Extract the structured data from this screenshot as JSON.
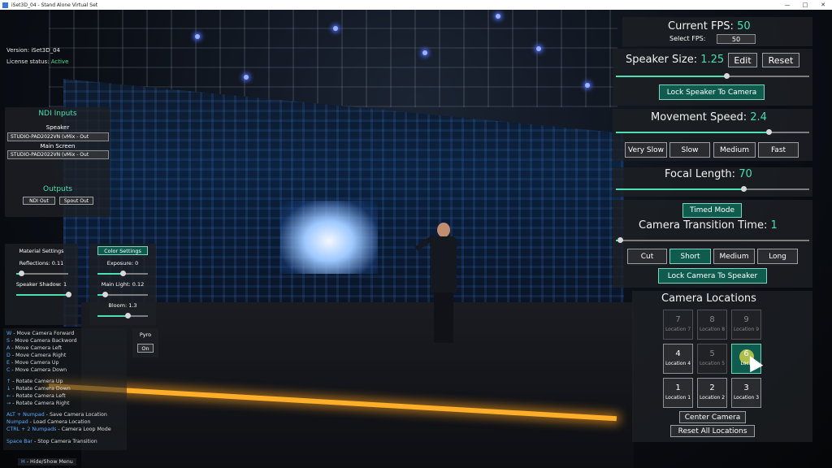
{
  "window": {
    "title": "iSet3D_04 - Stand Alone Virtual Set"
  },
  "info": {
    "version": "Version: iSet3D_04",
    "license_label": "License status:",
    "license_value": "Active"
  },
  "ndi": {
    "title": "NDI Inputs",
    "speaker_label": "Speaker",
    "speaker_value": "STUDIO-PAD2022VN (vMix - Out",
    "main_label": "Main Screen",
    "main_value": "STUDIO-PAD2022VN (vMix - Out",
    "outputs_title": "Outputs",
    "ndi_out": "NDI Out",
    "spout_out": "Spout Out"
  },
  "material": {
    "title": "Material Settings",
    "color_settings": "Color Settings",
    "reflections": "Reflections: 0.11",
    "reflections_level": 0.1,
    "speaker_shadow": "Speaker Shadow: 1",
    "speaker_shadow_level": 1,
    "exposure": "Exposure: 0",
    "exposure_level": 0.5,
    "main_light": "Main Light: 0.12",
    "main_light_level": 0.15,
    "bloom": "Bloom: 1.3",
    "bloom_level": 0.6
  },
  "pyro": {
    "label": "Pyro",
    "button": "On"
  },
  "shortcuts": {
    "camera_move": [
      {
        "key": "W",
        "desc": " - Move Camera Forward"
      },
      {
        "key": "S",
        "desc": " - Move Camera Backword"
      },
      {
        "key": "A",
        "desc": " - Move Camera Left"
      },
      {
        "key": "D",
        "desc": " - Move Camera Right"
      },
      {
        "key": "E",
        "desc": " - Move Camera Up"
      },
      {
        "key": "C",
        "desc": " - Move Camera Down"
      }
    ],
    "camera_rotate": [
      {
        "key": "↑",
        "desc": " - Rotate Camera Up"
      },
      {
        "key": "↓",
        "desc": " - Rotate Camera Down"
      },
      {
        "key": "←",
        "desc": " - Rotate Camera Left"
      },
      {
        "key": "→",
        "desc": " - Rotate Camera Right"
      }
    ],
    "location": [
      {
        "key": "ALT + Numpad",
        "desc": " - Save Camera Location"
      },
      {
        "key": "Numpad",
        "desc": " - Load Camera Location"
      },
      {
        "key": "CTRL + 2 Numpads",
        "desc": " - Camera Loop Mode"
      }
    ],
    "transition": {
      "key": "Space Bar",
      "desc": " - Stop Camera Transition"
    },
    "menu": {
      "key": "H",
      "desc": " - Hide/Show Menu"
    }
  },
  "right": {
    "fps_label": "Current FPS:",
    "fps_value": "50",
    "select_fps_label": "Select FPS:",
    "select_fps_value": "50",
    "speaker_size_label": "Speaker Size:",
    "speaker_size_value": "1.25",
    "speaker_size_level": 0.57,
    "edit": "Edit",
    "reset": "Reset",
    "lock_speaker": "Lock Speaker To Camera",
    "movement_label": "Movement Speed:",
    "movement_value": "2.4",
    "movement_level": 0.79,
    "speeds": [
      "Very Slow",
      "Slow",
      "Medium",
      "Fast"
    ],
    "focal_label": "Focal Length:",
    "focal_value": "70",
    "focal_level": 0.66,
    "timed_mode": "Timed Mode",
    "transition_label": "Camera Transition Time:",
    "transition_value": "1",
    "transition_level": 0.02,
    "transitions": [
      "Cut",
      "Short",
      "Medium",
      "Long"
    ],
    "lock_camera": "Lock Camera To Speaker",
    "locations_title": "Camera Locations",
    "locations": [
      {
        "num": "7",
        "label": "Location 7",
        "state": "dim"
      },
      {
        "num": "8",
        "label": "Location 8",
        "state": "dim"
      },
      {
        "num": "9",
        "label": "Location 9",
        "state": "dim"
      },
      {
        "num": "4",
        "label": "Location 4",
        "state": "normal"
      },
      {
        "num": "5",
        "label": "Location 5",
        "state": "dim"
      },
      {
        "num": "6",
        "label": "Loca",
        "state": "active"
      },
      {
        "num": "1",
        "label": "Location 1",
        "state": "normal"
      },
      {
        "num": "2",
        "label": "Location 2",
        "state": "normal"
      },
      {
        "num": "3",
        "label": "Location 3",
        "state": "normal"
      }
    ],
    "center_camera": "Center Camera",
    "reset_locations": "Reset  All Locations"
  }
}
